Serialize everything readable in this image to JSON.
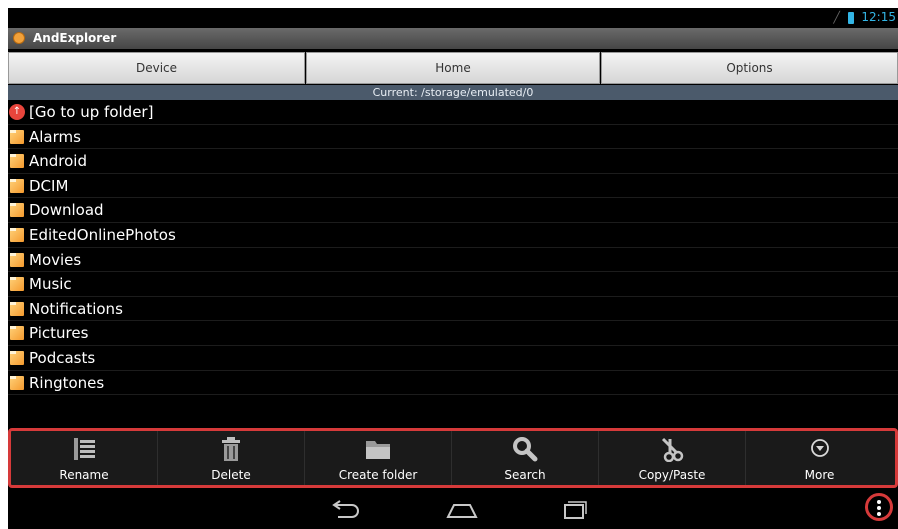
{
  "status": {
    "time": "12:15"
  },
  "app": {
    "title": "AndExplorer",
    "icon": "andexplorer-app-icon"
  },
  "top_buttons": {
    "device": "Device",
    "home": "Home",
    "options": "Options"
  },
  "current_path": "Current: /storage/emulated/0",
  "files": [
    {
      "name": "[Go to up folder]",
      "icon": "up-folder-icon"
    },
    {
      "name": "Alarms",
      "icon": "folder-icon"
    },
    {
      "name": "Android",
      "icon": "folder-icon"
    },
    {
      "name": "DCIM",
      "icon": "folder-icon"
    },
    {
      "name": "Download",
      "icon": "folder-icon"
    },
    {
      "name": "EditedOnlinePhotos",
      "icon": "folder-icon"
    },
    {
      "name": "Movies",
      "icon": "folder-icon"
    },
    {
      "name": "Music",
      "icon": "folder-icon"
    },
    {
      "name": "Notifications",
      "icon": "folder-icon"
    },
    {
      "name": "Pictures",
      "icon": "folder-icon"
    },
    {
      "name": "Podcasts",
      "icon": "folder-icon"
    },
    {
      "name": "Ringtones",
      "icon": "folder-icon"
    }
  ],
  "toolbar": {
    "rename": "Rename",
    "delete": "Delete",
    "create_folder": "Create folder",
    "search": "Search",
    "copy_paste": "Copy/Paste",
    "more": "More"
  },
  "colors": {
    "accent": "#33b5e5",
    "highlight": "#d63a3a",
    "folder": "#f59a2e",
    "path_bar": "#4b5a6b"
  }
}
